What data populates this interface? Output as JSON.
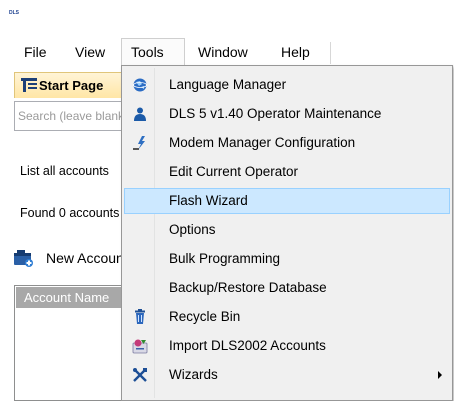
{
  "app": {
    "icon_text": "DLS"
  },
  "menu": {
    "file": "File",
    "view": "View",
    "tools": "Tools",
    "window": "Window",
    "help": "Help"
  },
  "tab": {
    "label": "Start Page"
  },
  "search": {
    "placeholder": "Search (leave blank for all)"
  },
  "list_text": "List all accounts",
  "found_text": "Found 0 accounts",
  "new_account": "New Account",
  "grid_header": "Account Name",
  "tools_menu": {
    "items": [
      {
        "label": "Language Manager",
        "icon": "language-icon"
      },
      {
        "label": "DLS 5 v1.40 Operator Maintenance",
        "icon": "operator-icon"
      },
      {
        "label": "Modem Manager Configuration",
        "icon": "modem-icon"
      },
      {
        "label": "Edit Current Operator",
        "icon": ""
      },
      {
        "label": "Flash Wizard",
        "icon": ""
      },
      {
        "label": "Options",
        "icon": ""
      },
      {
        "label": "Bulk Programming",
        "icon": ""
      },
      {
        "label": "Backup/Restore Database",
        "icon": ""
      },
      {
        "label": "Recycle Bin",
        "icon": "recycle-bin-icon"
      },
      {
        "label": "Import DLS2002 Accounts",
        "icon": "import-icon"
      },
      {
        "label": "Wizards",
        "icon": "wizards-icon"
      }
    ],
    "highlighted": "Flash Wizard"
  },
  "colors": {
    "highlight_bg": "#cce8ff",
    "highlight_border": "#99d1ff",
    "menu_bg": "#f0f0f0"
  }
}
